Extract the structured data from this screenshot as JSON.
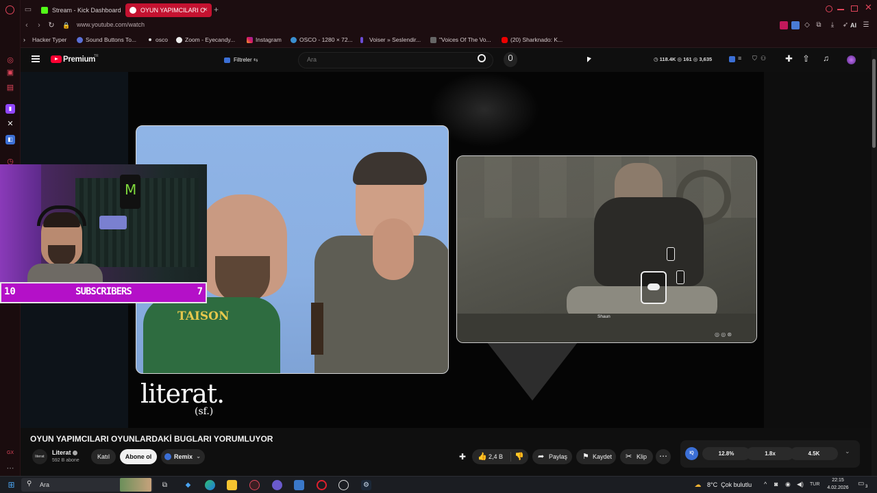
{
  "browser": {
    "tabs": [
      {
        "label": "Stream - Kick Dashboard",
        "fav_color": "#53fc18"
      },
      {
        "label": "OYUN YAPIMCILARI O",
        "fav_color": "#ff0033",
        "active": true
      }
    ],
    "new_tab": "+",
    "url": "www.youtube.com/watch",
    "toolbar_ai": "AI",
    "bookmarks": [
      {
        "label": "Hacker Typer",
        "icon": "chevron-icon"
      },
      {
        "label": "Sound Buttons To...",
        "icon": "sound-icon"
      },
      {
        "label": "osco",
        "icon": "dot-icon"
      },
      {
        "label": "Zoom - Eyecandy...",
        "icon": "zoom-icon"
      },
      {
        "label": "Instagram",
        "icon": "instagram-icon"
      },
      {
        "label": "OSCO - 1280 × 72...",
        "icon": "osco-icon"
      },
      {
        "label": "Voiser » Seslendir...",
        "icon": "voiser-icon"
      },
      {
        "label": "\"Voices Of The Vo...",
        "icon": "image-icon"
      },
      {
        "label": "(20) Sharknado: K...",
        "icon": "youtube-icon"
      }
    ]
  },
  "youtube": {
    "logo": "Premium",
    "region": "TR",
    "filter_label": "Filtreler",
    "search_placeholder": "Ara",
    "stats": {
      "views": "118.4K",
      "comments": "161",
      "likes": "3,635"
    },
    "video": {
      "title": "OYUN YAPIMCILARI OYUNLARDAKİ BUGLARI YORUMLUYOR",
      "brand_text": "literat.",
      "brand_sub": "(sf.)",
      "game_caption": "Shaun",
      "overlay": {
        "left_num": "10",
        "label": "SUBSCRIBERS",
        "right_num": "7"
      }
    },
    "channel": {
      "name": "Literat",
      "avatar_text": "literat",
      "subscribers": "592 B abone",
      "join_label": "Katıl",
      "subscribe_label": "Abone ol",
      "remix_label": "Remix"
    },
    "actions": {
      "likes": "2,4 B",
      "share": "Paylaş",
      "save": "Kaydet",
      "clip": "Klip"
    },
    "extension_stats": [
      "12.8%",
      "1.8x",
      "4.5K"
    ]
  },
  "taskbar": {
    "search_placeholder": "Ara",
    "weather": "8°C  Çok bulutlu",
    "lang": "TUR",
    "time": "22:15",
    "date": "4.02.2026",
    "notif_count": "3"
  }
}
